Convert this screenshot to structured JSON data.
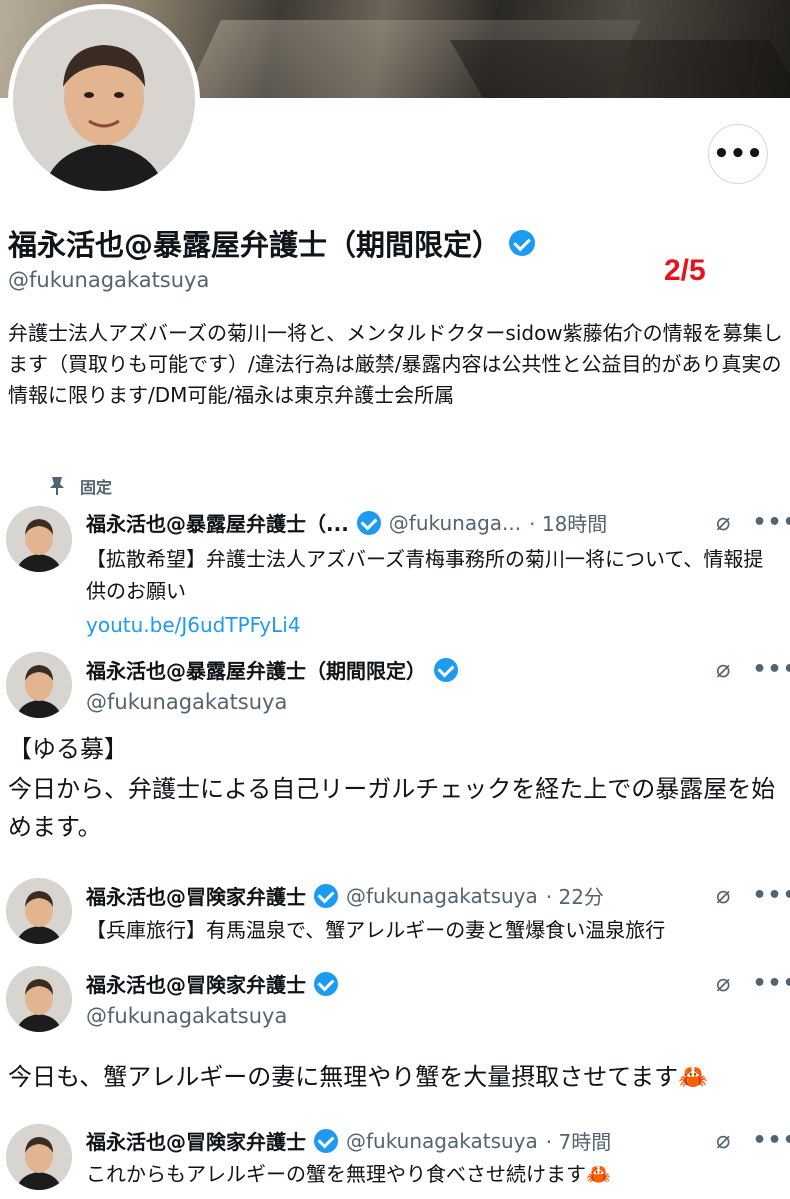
{
  "profile": {
    "display_name": "福永活也@暴露屋弁護士（期間限定）",
    "handle": "@fukunagakatsuya",
    "bio": "弁護士法人アズバーズの菊川一将と、メンタルドクターsidow紫藤佑介の情報を募集します（買取りも可能です）/違法行為は厳禁/暴露内容は公共性と公益目的があり真実の情報に限ります/DM可能/福永は東京弁護士会所属",
    "more_label": "•••"
  },
  "page_counter": "2/5",
  "pinned_label": "固定",
  "tweets": [
    {
      "name": "福永活也@暴露屋弁護士（...",
      "handle": "@fukunaga...",
      "time": "· 18時間",
      "text": "【拡散希望】弁護士法人アズバーズ青梅事務所の菊川一将について、情報提供のお願い",
      "link": "youtu.be/J6udTPFyLi4"
    },
    {
      "name": "福永活也@暴露屋弁護士（期間限定）",
      "handle": "@fukunagakatsuya",
      "text_line1": "【ゆる募】",
      "text_line2": "今日から、弁護士による自己リーガルチェックを経た上での暴露屋を始めます。"
    },
    {
      "name": "福永活也@冒険家弁護士",
      "handle": "@fukunagakatsuya",
      "time": "· 22分",
      "text": "【兵庫旅行】有馬温泉で、蟹アレルギーの妻と蟹爆食い温泉旅行"
    },
    {
      "name": "福永活也@冒険家弁護士",
      "handle": "@fukunagakatsuya",
      "text": "今日も、蟹アレルギーの妻に無理やり蟹を大量摂取させてます🦀"
    },
    {
      "name": "福永活也@冒険家弁護士",
      "handle": "@fukunagakatsuya",
      "time": "· 7時間",
      "text": "これからもアレルギーの蟹を無理やり食べさせ続けます🦀"
    }
  ],
  "icons": {
    "grok": "⌀",
    "more": "•••"
  },
  "colors": {
    "accent": "#1d9bf0",
    "counter": "#e8121b",
    "secondary_text": "#536471"
  }
}
